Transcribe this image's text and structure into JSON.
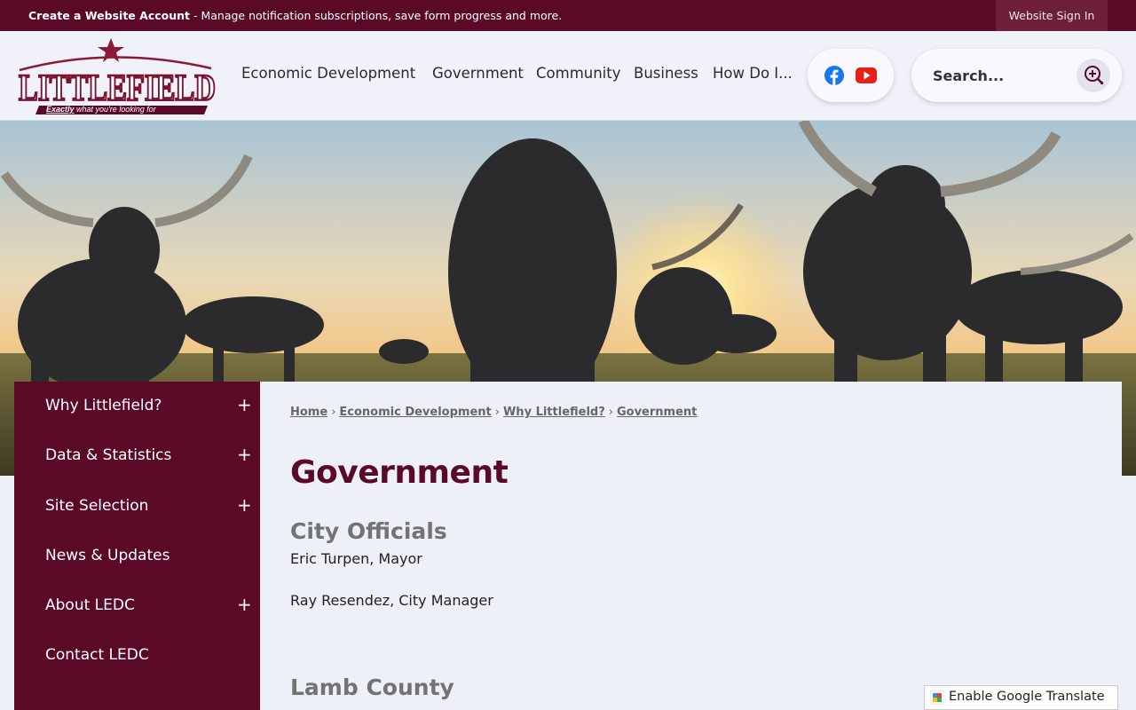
{
  "topbar": {
    "create_account": "Create a Website Account",
    "message": " - Manage notification subscriptions, save form progress and more.",
    "sign_in": "Website Sign In"
  },
  "logo": {
    "name": "LITTLEFIELD",
    "tagline_em": "Exactly",
    "tagline": " what you're looking for"
  },
  "nav": {
    "items": [
      "Economic Development",
      "Government",
      "Community",
      "Business",
      "How Do I..."
    ]
  },
  "social": {
    "icons": [
      "facebook-icon",
      "youtube-icon"
    ]
  },
  "search": {
    "placeholder": "Search..."
  },
  "sidebar": {
    "items": [
      {
        "label": "Why Littlefield?",
        "expandable": true
      },
      {
        "label": "Data & Statistics",
        "expandable": true
      },
      {
        "label": "Site Selection",
        "expandable": true
      },
      {
        "label": "News & Updates",
        "expandable": false
      },
      {
        "label": "About LEDC",
        "expandable": true
      },
      {
        "label": "Contact LEDC",
        "expandable": false
      }
    ],
    "expand_symbol": "+"
  },
  "breadcrumb": [
    "Home",
    "Economic Development",
    "Why Littlefield?",
    "Government"
  ],
  "breadcrumb_sep": "›",
  "page": {
    "title": "Government",
    "sections": [
      {
        "heading": "City Officials",
        "lines": [
          "Eric Turpen, Mayor",
          "Ray Resendez, City Manager"
        ]
      },
      {
        "heading": "Lamb County"
      }
    ]
  },
  "translate": {
    "label": "Enable Google Translate"
  },
  "colors": {
    "brand": "#5a0a26",
    "background": "#eef0f8"
  }
}
